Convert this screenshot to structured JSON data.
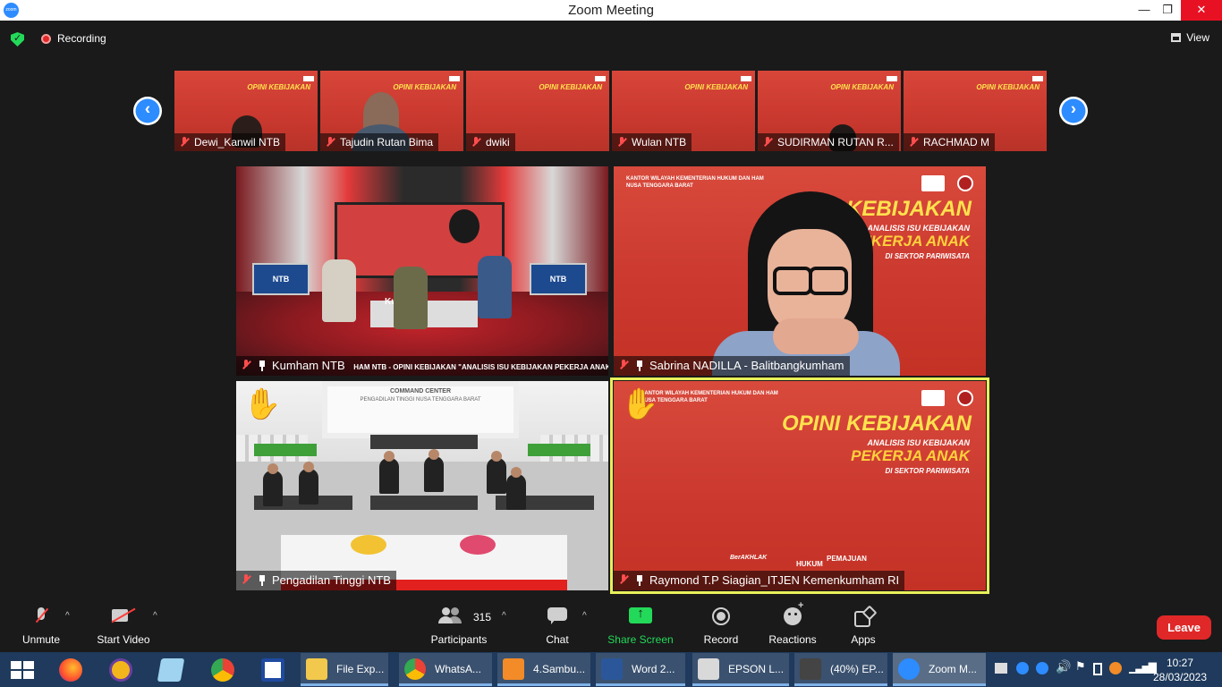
{
  "window": {
    "title": "Zoom Meeting",
    "app_icon": "zoom",
    "minimize": "—",
    "restore": "❐",
    "close": "✕"
  },
  "topbar": {
    "recording_label": "Recording",
    "view_label": "View",
    "shield": "security-shield-icon"
  },
  "strip": {
    "thumbnails": [
      {
        "name": "Dewi_Kanwil NTB",
        "muted": true
      },
      {
        "name": "Tajudin Rutan Bima",
        "muted": true
      },
      {
        "name": "dwiki",
        "muted": true
      },
      {
        "name": "Wulan NTB",
        "muted": true
      },
      {
        "name": "SUDIRMAN RUTAN R...",
        "muted": true
      },
      {
        "name": "RACHMAD M",
        "muted": true
      }
    ],
    "poster_title": "OPINI KEBIJAKAN",
    "prev_arrow": "‹",
    "next_arrow": "›"
  },
  "gallery": {
    "tiles": [
      {
        "name": "Kumham NTB",
        "ticker": "HAM NTB - OPINI KEBIJAKAN \"ANALISIS ISU KEBIJAKAN PEKERJA ANAK DI S",
        "monitor_label": "NTB",
        "desk_label": "Kumham",
        "hand_raised": false
      },
      {
        "name": "Sabrina NADILLA - Balitbangkumham",
        "hand_raised": false
      },
      {
        "name": "Pengadilan Tinggi NTB",
        "hand_raised": true,
        "wall_title": "COMMAND CENTER",
        "wall_subtitle": "PENGADILAN TINGGI NUSA TENGGARA BARAT"
      },
      {
        "name": "Raymond T.P Siagian_ITJEN Kemenkumham RI",
        "hand_raised": true,
        "active_speaker": true
      }
    ],
    "poster": {
      "header_line1": "KANTOR WILAYAH KEMENTERIAN HUKUM DAN HAM",
      "header_line2": "NUSA TENGGARA BARAT",
      "opini": "OPINI KEBIJAKAN",
      "analisis": "ANALISIS ISU KEBIJAKAN",
      "pekerja": "PEKERJA ANAK",
      "sektor": "DI SEKTOR PARIWISATA",
      "footer_berakhlak": "BerAKHLAK",
      "footer_hukum": "HUKUM",
      "footer_pemajuan": "PEMAJUAN"
    }
  },
  "toolbar": {
    "unmute": "Unmute",
    "start_video": "Start Video",
    "participants": "Participants",
    "participants_count": "315",
    "chat": "Chat",
    "share_screen": "Share Screen",
    "record": "Record",
    "reactions": "Reactions",
    "apps": "Apps",
    "leave": "Leave",
    "caret": "^"
  },
  "taskbar": {
    "tasks": [
      {
        "label": "File Exp...",
        "icon": "folder-icon"
      },
      {
        "label": "WhatsA...",
        "icon": "chrome-icon"
      },
      {
        "label": "4.Sambu...",
        "icon": "pdf-icon"
      },
      {
        "label": "Word 2...",
        "icon": "word-icon"
      },
      {
        "label": "EPSON L...",
        "icon": "scanner-icon"
      },
      {
        "label": "(40%) EP...",
        "icon": "printer-icon"
      },
      {
        "label": "Zoom M...",
        "icon": "zoom-icon"
      }
    ],
    "time": "10:27",
    "date": "28/03/2023"
  },
  "colors": {
    "zoom_blue": "#2d8cff",
    "leave_red": "#e02828",
    "share_green": "#23d959",
    "speaker_border": "#e8f05a",
    "poster_red": "#cc3a30"
  }
}
